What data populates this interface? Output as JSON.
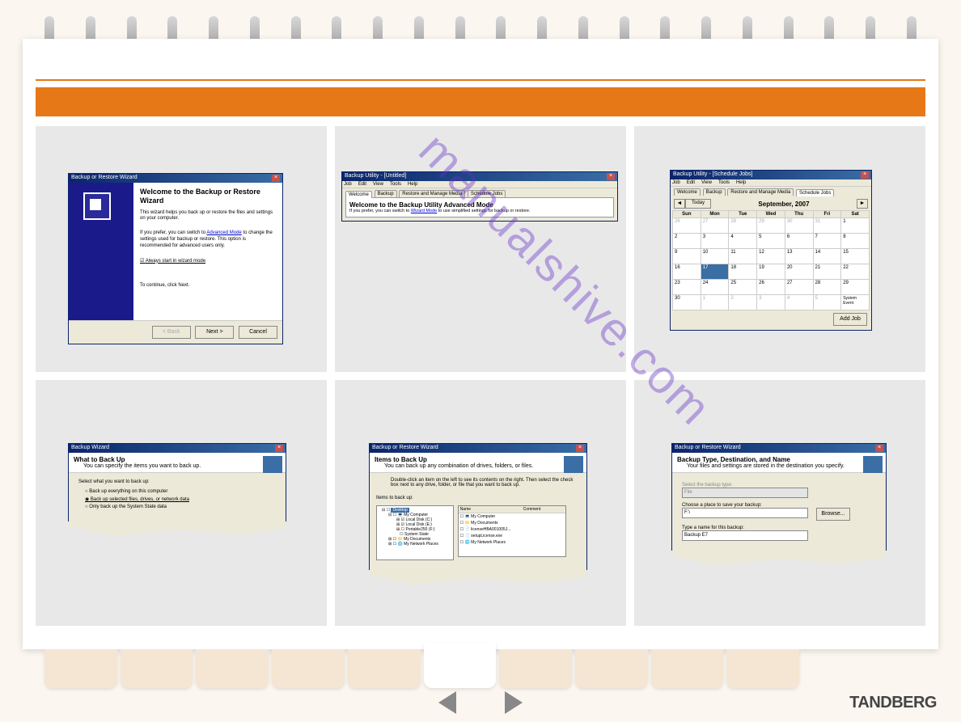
{
  "brand": "TANDBERG",
  "watermark": "manualshive.com",
  "thumb1": {
    "title": "Backup or Restore Wizard",
    "heading": "Welcome to the Backup or Restore Wizard",
    "p1": "This wizard helps you back up or restore the files and settings on your computer.",
    "p2a": "If you prefer, you can switch to ",
    "p2link": "Advanced Mode",
    "p2b": " to change the settings used for backup or restore. This option is recommended for advanced users only.",
    "checkbox": "Always start in wizard mode",
    "continue": "To continue, click Next.",
    "back": "< Back",
    "next": "Next >",
    "cancel": "Cancel"
  },
  "thumb2": {
    "title": "Backup Utility - [Untitled]",
    "menu": {
      "job": "Job",
      "edit": "Edit",
      "view": "View",
      "tools": "Tools",
      "help": "Help"
    },
    "tabs": {
      "welcome": "Welcome",
      "backup": "Backup",
      "restore": "Restore and Manage Media",
      "schedule": "Schedule Jobs"
    },
    "heading": "Welcome to the Backup Utility Advanced Mode",
    "suba": "If you prefer, you can switch to ",
    "sublink": "Wizard Mode",
    "subb": " to use simplified settings for backup or restore."
  },
  "thumb3": {
    "title": "Backup Utility - [Schedule Jobs]",
    "menu": {
      "job": "Job",
      "edit": "Edit",
      "view": "View",
      "tools": "Tools",
      "help": "Help"
    },
    "tabs": {
      "welcome": "Welcome",
      "backup": "Backup",
      "restore": "Restore and Manage Media",
      "schedule": "Schedule Jobs"
    },
    "today": "Today",
    "month": "September, 2007",
    "days": [
      "Sun",
      "Mon",
      "Tue",
      "Wed",
      "Thu",
      "Fri",
      "Sat"
    ],
    "event": "System Event",
    "add": "Add Job"
  },
  "thumb4": {
    "title": "Backup Wizard",
    "heading": "What to Back Up",
    "subtitle": "You can specify the items you want to back up.",
    "prompt": "Select what you want to back up:",
    "opt1": "Back up everything on this computer",
    "opt2": "Back up selected files, drives, or network data",
    "opt3": "Only back up the System State data"
  },
  "thumb5": {
    "title": "Backup or Restore Wizard",
    "heading": "Items to Back Up",
    "subtitle": "You can back up any combination of drives, folders, or files.",
    "inst": "Double-click an item on the left to see its contents on the right. Then select the check box next to any drive, folder, or file that you want to back up.",
    "itemslabel": "Items to back up:",
    "col_name": "Name",
    "col_comment": "Comment",
    "tree": {
      "desktop": "Desktop",
      "mycomp": "My Computer",
      "c": "Local Disk (C:)",
      "e": "Local Disk (E:)",
      "f": "Portable250 (F:)",
      "sys": "System State",
      "docs": "My Documents",
      "net": "My Network Places"
    },
    "list": {
      "mycomp": "My Computer",
      "docs": "My Documents",
      "lic": "licenseHBA001005J...",
      "setup": "setupLicense.exe",
      "net": "My Network Places"
    }
  },
  "thumb6": {
    "title": "Backup or Restore Wizard",
    "heading": "Backup Type, Destination, and Name",
    "subtitle": "Your files and settings are stored in the destination you specify.",
    "lbl_type": "Select the backup type:",
    "val_type": "File",
    "lbl_place": "Choose a place to save your backup:",
    "val_place": "F:\\",
    "browse": "Browse...",
    "lbl_name": "Type a name for this backup:",
    "val_name": "Backup E7"
  }
}
